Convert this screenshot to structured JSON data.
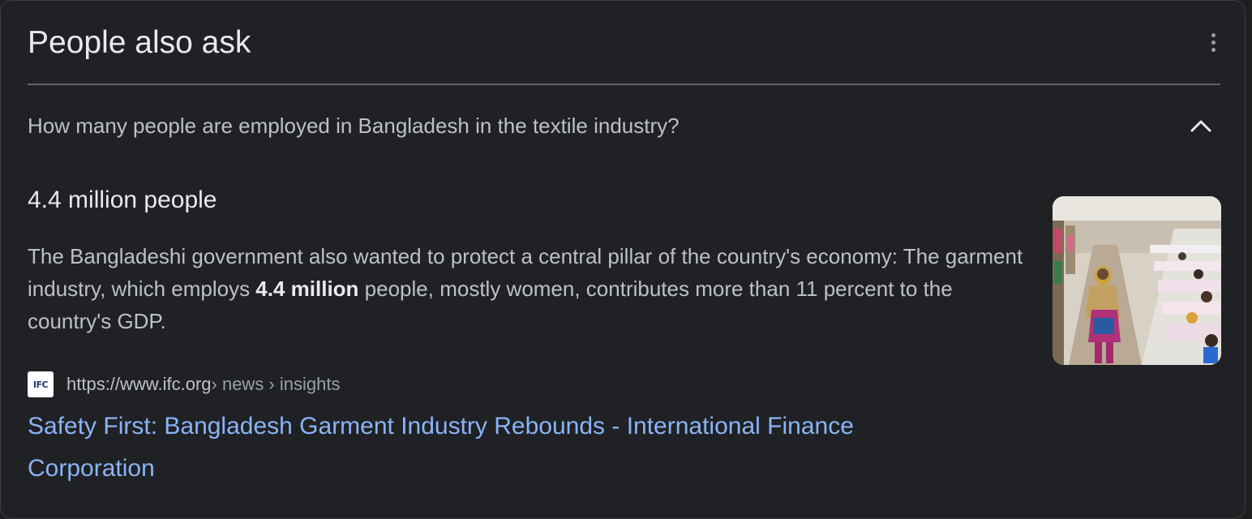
{
  "header": {
    "title": "People also ask",
    "more_icon": "more-vert-icon"
  },
  "question": {
    "text": "How many people are employed in Bangladesh in the textile industry?",
    "expanded": true,
    "chevron_icon": "chevron-up-icon"
  },
  "answer": {
    "headline": "4.4 million people",
    "snippet_before": "The Bangladeshi government also wanted to protect a central pillar of the country's economy: The garment industry, which employs ",
    "snippet_bold": "4.4 million",
    "snippet_after": " people, mostly women, contributes more than 11 percent to the country's GDP."
  },
  "source": {
    "favicon_text": "IFC",
    "url": "https://www.ifc.org",
    "path": " › news › insights",
    "link_title": "Safety First: Bangladesh Garment Industry Rebounds - International Finance Corporation"
  },
  "colors": {
    "background": "#202124",
    "text_primary": "#e8eaed",
    "text_secondary": "#bdc1c6",
    "link": "#8ab4f8"
  }
}
